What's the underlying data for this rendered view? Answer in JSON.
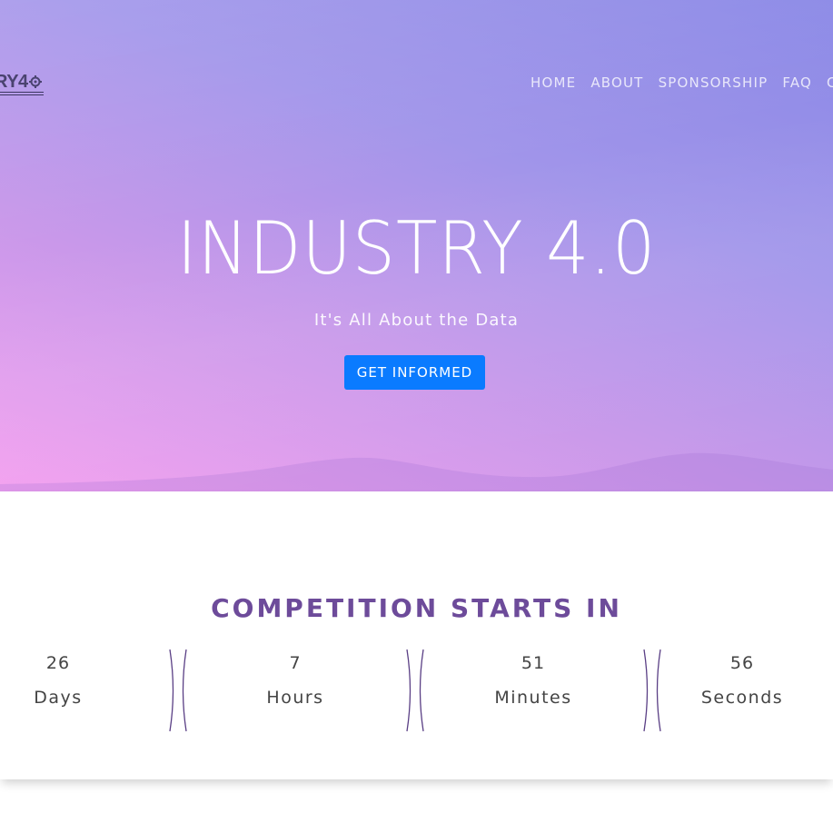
{
  "header": {
    "logo_text": "RY4",
    "nav": [
      "HOME",
      "ABOUT",
      "SPONSORSHIP",
      "FAQ",
      "C"
    ]
  },
  "hero": {
    "title": "INDUSTRY 4.0",
    "subtitle": "It's All About the Data",
    "cta_label": "GET INFORMED"
  },
  "countdown": {
    "heading": "COMPETITION STARTS IN",
    "units": [
      {
        "value": "26",
        "label": "Days"
      },
      {
        "value": "7",
        "label": "Hours"
      },
      {
        "value": "51",
        "label": "Minutes"
      },
      {
        "value": "56",
        "label": "Seconds"
      }
    ]
  },
  "colors": {
    "accent_button": "#0a7bff",
    "heading": "#6d4b9a",
    "divider": "#5a3f85",
    "gradient_top": "#8a88e6",
    "gradient_bottom": "#f3a0ef"
  },
  "icons": {
    "logo_gear": "gear-icon"
  }
}
